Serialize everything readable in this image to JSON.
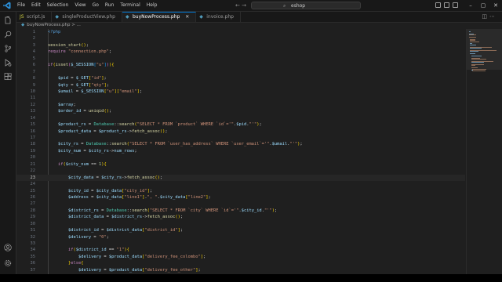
{
  "menu": [
    "File",
    "Edit",
    "Selection",
    "View",
    "Go",
    "Run",
    "Terminal",
    "Help"
  ],
  "search": {
    "text": "eshop"
  },
  "tabs": [
    {
      "label": "script.js",
      "icon": "js-file-icon",
      "active": false
    },
    {
      "label": "singleProductView.php",
      "icon": "php-file-icon",
      "active": false
    },
    {
      "label": "buyNowProcess.php",
      "icon": "php-file-icon",
      "active": true
    },
    {
      "label": "invoice.php",
      "icon": "php-file-icon",
      "active": false
    }
  ],
  "breadcrumb": {
    "file": "buyNowProcess.php",
    "sep": ">",
    "rest": "..."
  },
  "editor": {
    "current_line": 23,
    "lines": [
      {
        "n": "1",
        "code": "<?php"
      },
      {
        "n": "2",
        "code": ""
      },
      {
        "n": "3",
        "code": "session_start();"
      },
      {
        "n": "4",
        "code": "require \"connection.php\";"
      },
      {
        "n": "5",
        "code": ""
      },
      {
        "n": "6",
        "code": "if(isset($_SESSION[\"u\"])){"
      },
      {
        "n": "7",
        "code": ""
      },
      {
        "n": "8",
        "code": "    $pid = $_GET[\"id\"];"
      },
      {
        "n": "9",
        "code": "    $qty = $_GET[\"qty\"];"
      },
      {
        "n": "10",
        "code": "    $umail = $_SESSION[\"u\"][\"email\"];"
      },
      {
        "n": "11",
        "code": ""
      },
      {
        "n": "12",
        "code": "    $array;"
      },
      {
        "n": "13",
        "code": "    $order_id = uniqid();"
      },
      {
        "n": "14",
        "code": ""
      },
      {
        "n": "15",
        "code": "    $product_rs = Database::search(\"SELECT * FROM `product` WHERE `id`='\".$pid.\"'\");"
      },
      {
        "n": "16",
        "code": "    $product_data = $product_rs->fetch_assoc();"
      },
      {
        "n": "17",
        "code": ""
      },
      {
        "n": "18",
        "code": "    $city_rs = Database::search(\"SELECT * FROM `user_has_address` WHERE `user_email`='\".$umail.\"'\");"
      },
      {
        "n": "19",
        "code": "    $city_num = $city_rs->num_rows;"
      },
      {
        "n": "20",
        "code": ""
      },
      {
        "n": "21",
        "code": "    if($city_num == 1){"
      },
      {
        "n": "22",
        "code": ""
      },
      {
        "n": "23",
        "code": "        $city_data = $city_rs->fetch_assoc();"
      },
      {
        "n": "24",
        "code": ""
      },
      {
        "n": "25",
        "code": "        $city_id = $city_data[\"city_id\"];"
      },
      {
        "n": "26",
        "code": "        $address = $city_data[\"line1\"].\", \".$city_data[\"line2\"];"
      },
      {
        "n": "27",
        "code": ""
      },
      {
        "n": "28",
        "code": "        $district_rs = Database::search(\"SELECT * FROM `city` WHERE `id`='\".$city_id.\"'\");"
      },
      {
        "n": "29",
        "code": "        $district_data = $district_rs->fetch_assoc();"
      },
      {
        "n": "30",
        "code": ""
      },
      {
        "n": "31",
        "code": "        $district_id = $district_data[\"district_id\"];"
      },
      {
        "n": "32",
        "code": "        $delivery = \"0\";"
      },
      {
        "n": "33",
        "code": ""
      },
      {
        "n": "34",
        "code": "        if($district_id == \"1\"){"
      },
      {
        "n": "35",
        "code": "            $delivery = $product_data[\"delivery_fee_colombo\"];"
      },
      {
        "n": "36",
        "code": "        }else{"
      },
      {
        "n": "37",
        "code": "            $delivery = $product_data[\"delivery_fee_other\"];"
      }
    ]
  },
  "colors": {
    "accent": "#0078d4",
    "editor_bg": "#1f1f1f",
    "variable": "#9cdcfe",
    "string": "#ce9178",
    "function": "#dcdcaa",
    "keyword": "#c586c0",
    "class": "#4ec9b0"
  },
  "icons": {
    "activity": [
      "explorer-icon",
      "search-icon",
      "source-control-icon",
      "run-debug-icon",
      "extensions-icon"
    ],
    "activity_bottom": [
      "account-icon",
      "settings-gear-icon"
    ]
  }
}
